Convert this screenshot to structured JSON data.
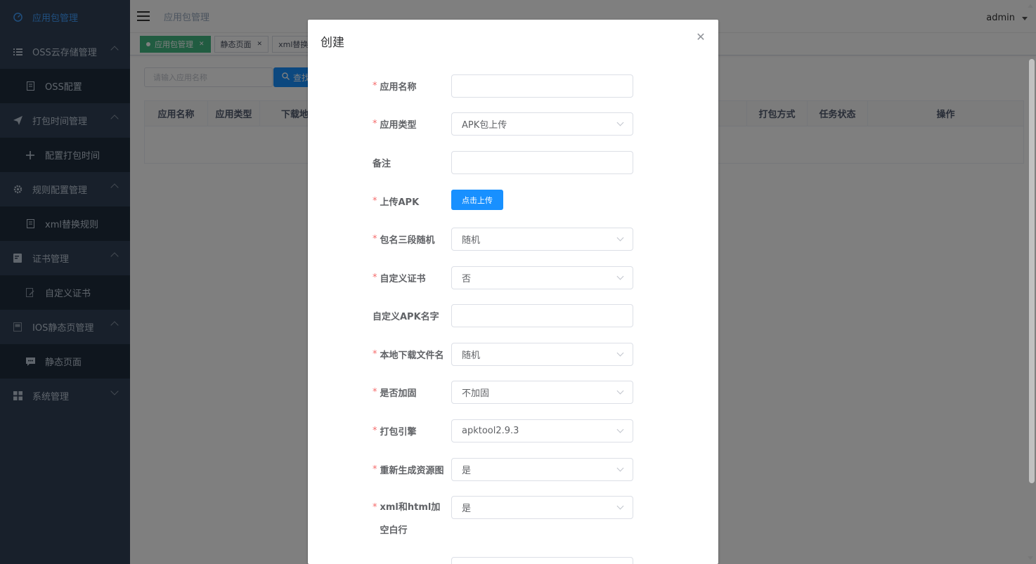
{
  "sidebar": {
    "items": [
      {
        "label": "应用包管理",
        "icon": "dashboard-icon",
        "active": true
      },
      {
        "label": "OSS云存储管理",
        "icon": "list-icon"
      },
      {
        "label": "OSS配置",
        "icon": "document-icon",
        "sub": true
      },
      {
        "label": "打包时间管理",
        "icon": "send-icon"
      },
      {
        "label": "配置打包时间",
        "icon": "move-icon",
        "sub": true
      },
      {
        "label": "规则配置管理",
        "icon": "gear-icon"
      },
      {
        "label": "xml替换规则",
        "icon": "document-icon",
        "sub": true
      },
      {
        "label": "证书管理",
        "icon": "certificate-icon"
      },
      {
        "label": "自定义证书",
        "icon": "document-edit-icon",
        "sub": true
      },
      {
        "label": "IOS静态页管理",
        "icon": "page-icon"
      },
      {
        "label": "静态页面",
        "icon": "chat-icon",
        "sub": true
      },
      {
        "label": "系统管理",
        "icon": "grid-icon"
      }
    ]
  },
  "header": {
    "breadcrumb": "应用包管理",
    "user": "admin"
  },
  "tags": [
    {
      "label": "应用包管理",
      "active": true
    },
    {
      "label": "静态页面"
    },
    {
      "label": "xml替换"
    }
  ],
  "search": {
    "placeholder": "请输入应用名称",
    "button_label": "查找"
  },
  "table": {
    "columns": [
      "应用名称",
      "应用类型",
      "下载地",
      "打包方式",
      "任务状态",
      "操作"
    ]
  },
  "dialog": {
    "title": "创建",
    "close_icon": "close-icon",
    "fields": [
      {
        "label": "应用名称",
        "required": true,
        "type": "input",
        "value": ""
      },
      {
        "label": "应用类型",
        "required": true,
        "type": "select",
        "value": "APK包上传"
      },
      {
        "label": "备注",
        "required": false,
        "type": "input",
        "value": ""
      },
      {
        "label": "上传APK",
        "required": true,
        "type": "upload",
        "value": "点击上传"
      },
      {
        "label": "包名三段随机",
        "required": true,
        "type": "select",
        "value": "随机"
      },
      {
        "label": "自定义证书",
        "required": true,
        "type": "select",
        "value": "否"
      },
      {
        "label": "自定义APK名字",
        "required": false,
        "type": "input",
        "value": ""
      },
      {
        "label": "本地下载文件名",
        "required": true,
        "type": "select",
        "value": "随机"
      },
      {
        "label": "是否加固",
        "required": true,
        "type": "select",
        "value": "不加固"
      },
      {
        "label": "打包引擎",
        "required": true,
        "type": "select",
        "value": "apktool2.9.3"
      },
      {
        "label": "重新生成资源图",
        "required": true,
        "type": "select",
        "value": "是"
      },
      {
        "label": "xml和html加空白行",
        "required": true,
        "type": "select",
        "value": "是"
      }
    ]
  }
}
